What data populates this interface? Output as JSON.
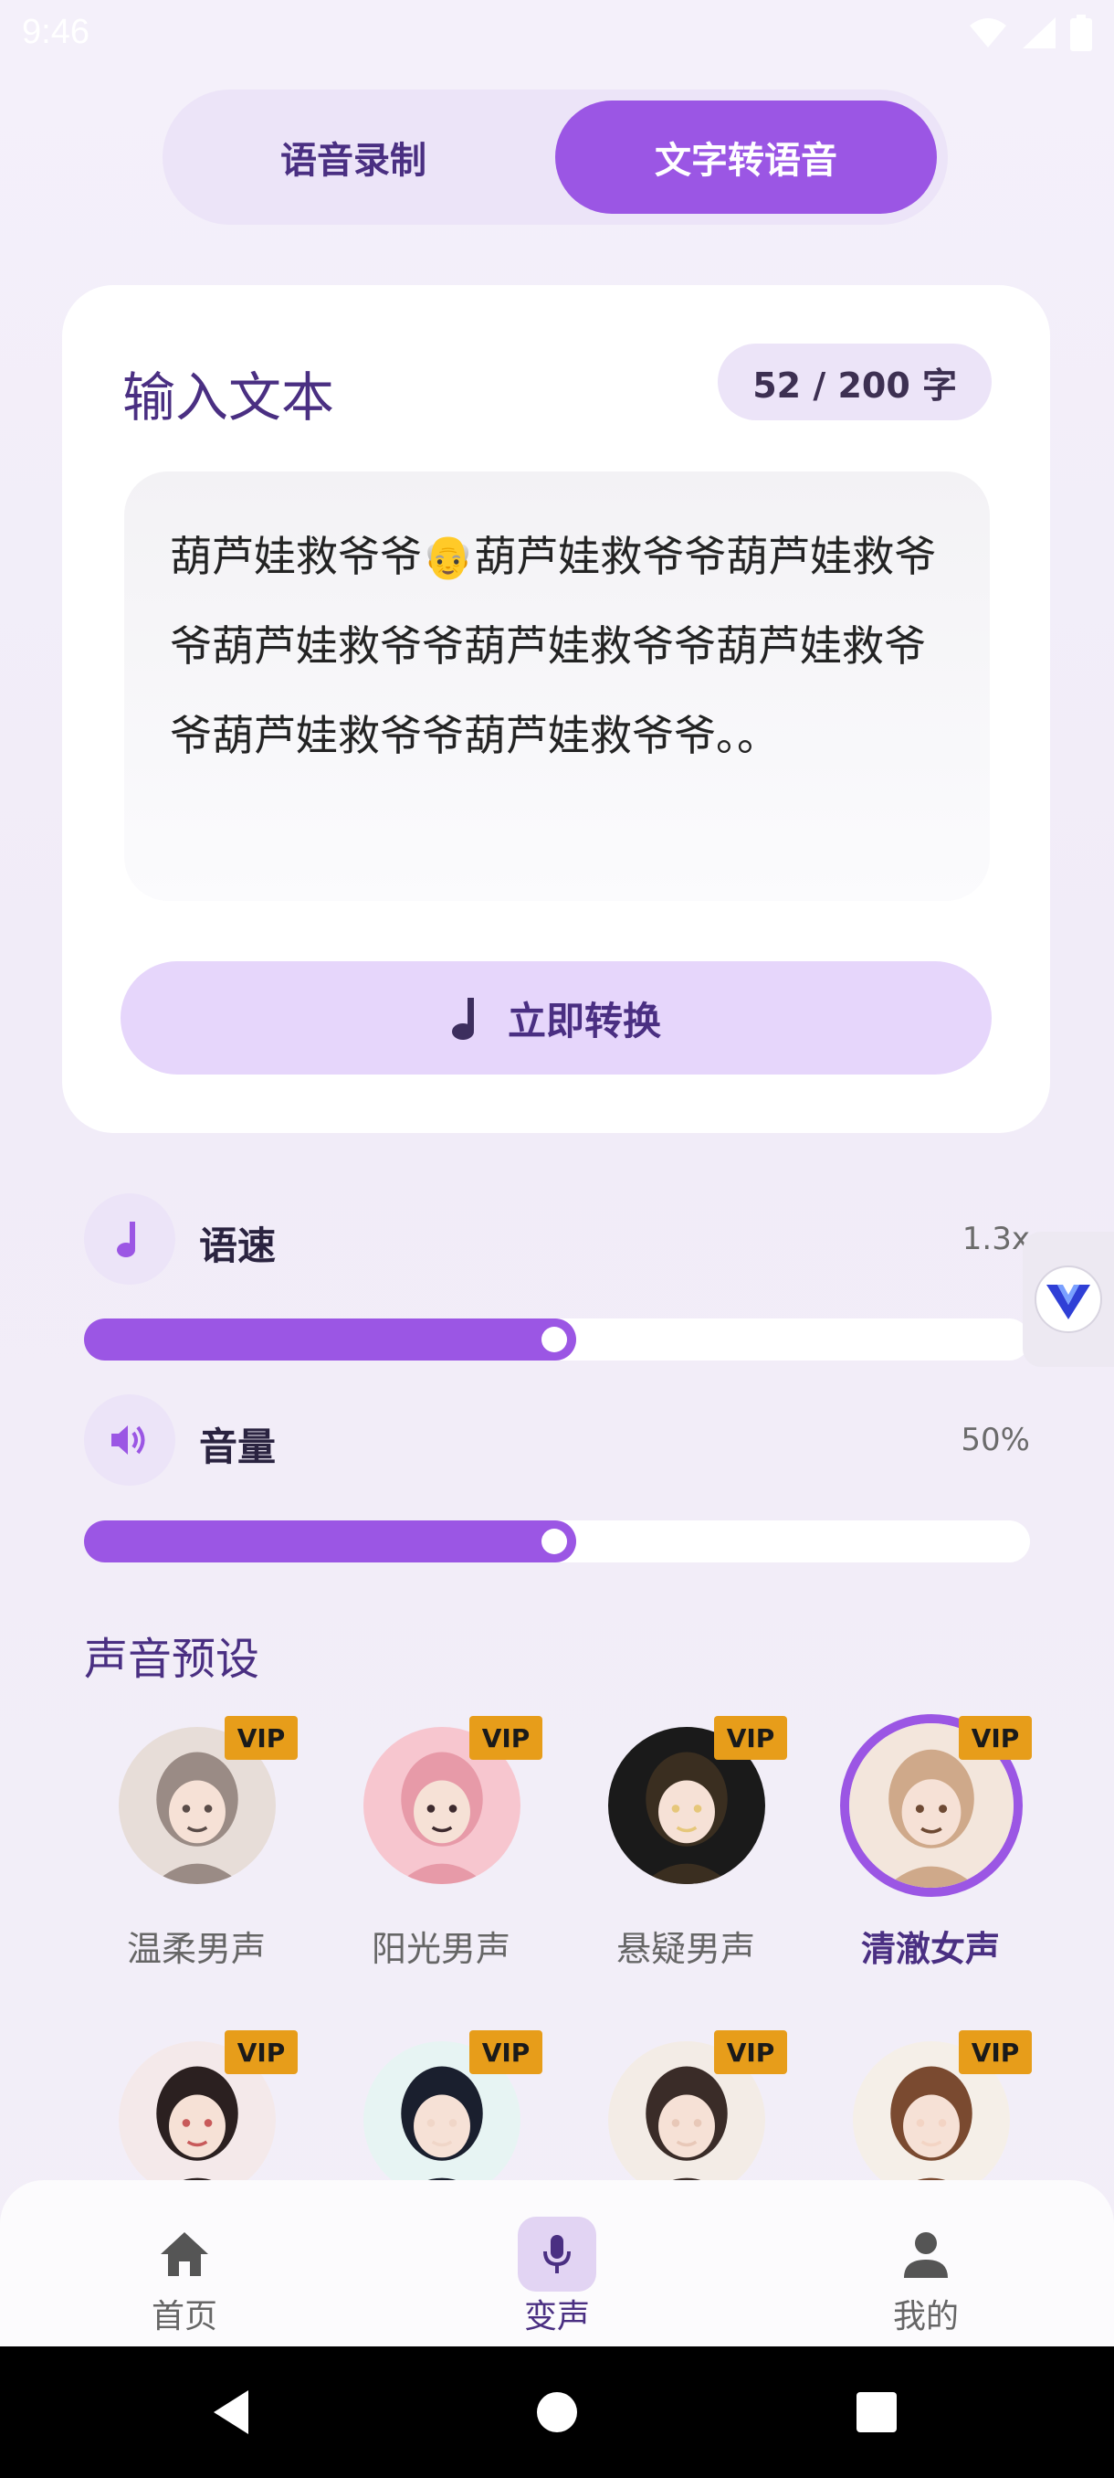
{
  "status_bar": {
    "time": "9:46"
  },
  "tabs": [
    {
      "label": "语音录制",
      "active": false
    },
    {
      "label": "文字转语音",
      "active": true
    }
  ],
  "input_card": {
    "title": "输入文本",
    "char_count": "52 / 200 字",
    "text": "葫芦娃救爷爷👴葫芦娃救爷爷葫芦娃救爷爷葫芦娃救爷爷葫芦娃救爷爷葫芦娃救爷爷葫芦娃救爷爷葫芦娃救爷爷。。",
    "convert_button": "立即转换"
  },
  "settings": {
    "speed": {
      "label": "语速",
      "value": "1.3x",
      "fill_fraction": 0.52,
      "icon": "music-note-icon"
    },
    "volume": {
      "label": "音量",
      "value": "50%",
      "fill_fraction": 0.52,
      "icon": "speaker-icon"
    }
  },
  "presets": {
    "title": "声音预设",
    "items": [
      {
        "name": "温柔男声",
        "vip": "VIP",
        "selected": false
      },
      {
        "name": "阳光男声",
        "vip": "VIP",
        "selected": false
      },
      {
        "name": "悬疑男声",
        "vip": "VIP",
        "selected": false
      },
      {
        "name": "清澈女声",
        "vip": "VIP",
        "selected": true
      },
      {
        "name": "",
        "vip": "VIP",
        "selected": false
      },
      {
        "name": "",
        "vip": "VIP",
        "selected": false
      },
      {
        "name": "",
        "vip": "VIP",
        "selected": false
      },
      {
        "name": "",
        "vip": "VIP",
        "selected": false
      }
    ]
  },
  "bottom_nav": [
    {
      "label": "首页",
      "icon": "home-icon",
      "active": false
    },
    {
      "label": "变声",
      "icon": "microphone-icon",
      "active": true
    },
    {
      "label": "我的",
      "icon": "person-icon",
      "active": false
    }
  ],
  "colors": {
    "accent": "#9b56e4",
    "accent_light": "#ece4f8",
    "title_purple": "#4a2f82",
    "vip_gold": "#e79d1a"
  }
}
